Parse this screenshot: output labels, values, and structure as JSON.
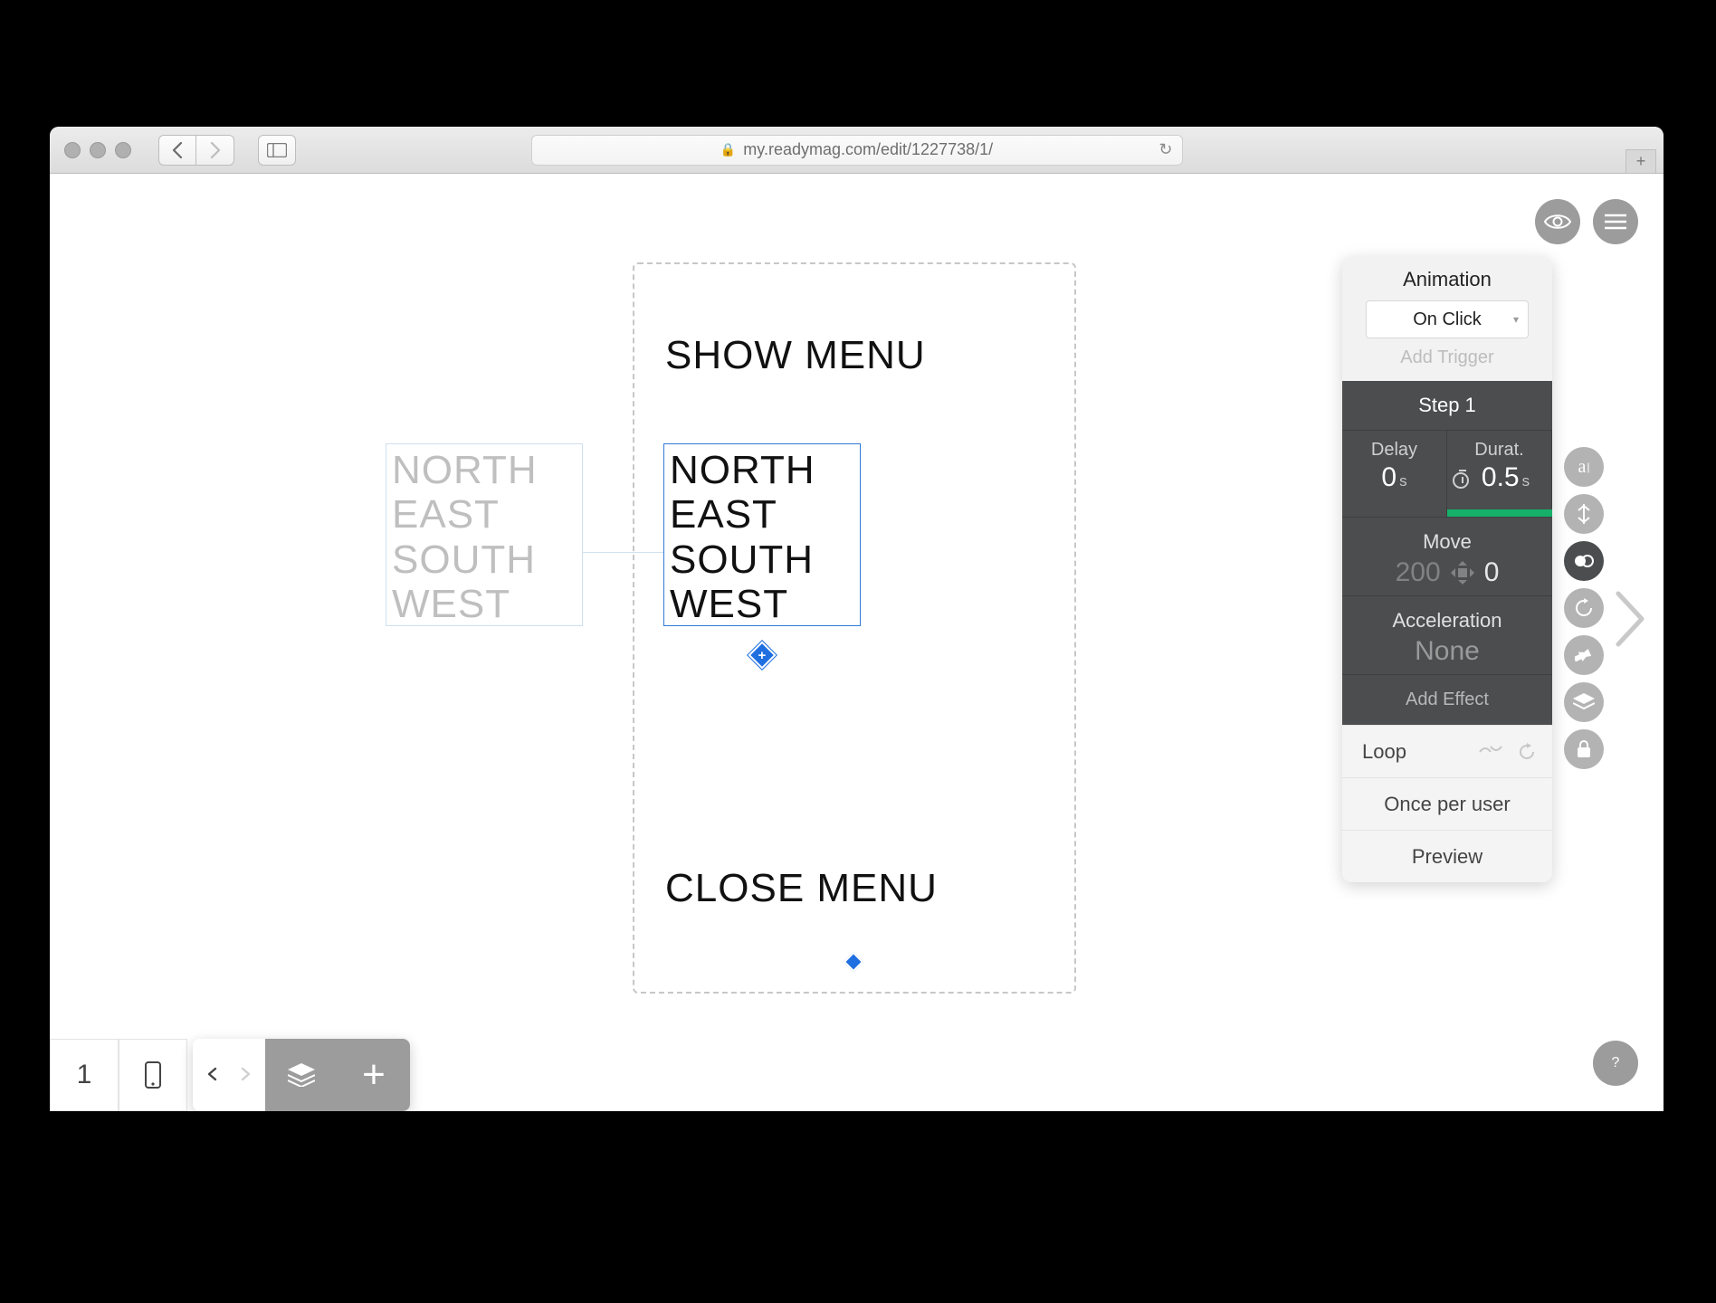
{
  "browser": {
    "url": "my.readymag.com/edit/1227738/1/"
  },
  "canvas": {
    "show_menu_label": "SHOW MENU",
    "close_menu_label": "CLOSE MENU",
    "menu_items": [
      "NORTH",
      "EAST",
      "SOUTH",
      "WEST"
    ]
  },
  "panel": {
    "title": "Animation",
    "trigger": "On Click",
    "add_trigger": "Add Trigger",
    "step_title": "Step 1",
    "delay_label": "Delay",
    "delay_value": "0",
    "delay_unit": "s",
    "duration_label": "Durat.",
    "duration_value": "0.5",
    "duration_unit": "s",
    "move_label": "Move",
    "move_x": "200",
    "move_y": "0",
    "accel_label": "Acceleration",
    "accel_value": "None",
    "add_effect": "Add Effect",
    "loop_label": "Loop",
    "once_label": "Once per user",
    "preview_label": "Preview"
  },
  "bottom": {
    "page_number": "1"
  },
  "help": "?"
}
